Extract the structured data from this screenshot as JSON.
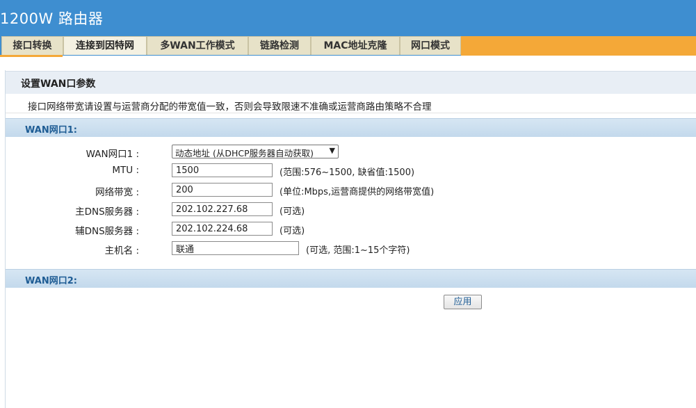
{
  "app": {
    "title": "1200W 路由器"
  },
  "tabs": [
    {
      "label": "接口转换"
    },
    {
      "label": "连接到因特网"
    },
    {
      "label": "多WAN工作模式"
    },
    {
      "label": "链路检测"
    },
    {
      "label": "MAC地址克隆"
    },
    {
      "label": "网口模式"
    }
  ],
  "section": {
    "title": "设置WAN口参数"
  },
  "notice": "接口网络带宽请设置与运营商分配的带宽值一致，否则会导致限速不准确或运营商路由策略不合理",
  "wan1": {
    "header": "WAN网口1:",
    "mode_label": "WAN网口1 :",
    "mode_value": "动态地址 (从DHCP服务器自动获取)",
    "mtu_label": "MTU :",
    "mtu_value": "1500",
    "mtu_hint": "(范围:576~1500, 缺省值:1500)",
    "bandwidth_label": "网络带宽 :",
    "bandwidth_value": "200",
    "bandwidth_hint": "(单位:Mbps,运营商提供的网络带宽值)",
    "dns1_label": "主DNS服务器 :",
    "dns1_value": "202.102.227.68",
    "dns1_hint": "(可选)",
    "dns2_label": "辅DNS服务器 :",
    "dns2_value": "202.102.224.68",
    "dns2_hint": "(可选)",
    "hostname_label": "主机名 :",
    "hostname_value": "联通",
    "hostname_hint": "(可选, 范围:1~15个字符)"
  },
  "wan2": {
    "header": "WAN网口2:"
  },
  "apply_label": "应用",
  "colors": {
    "header": "#3e8ed0",
    "tab_accent": "#f4a838",
    "section_bar": "#c3d9ec"
  }
}
